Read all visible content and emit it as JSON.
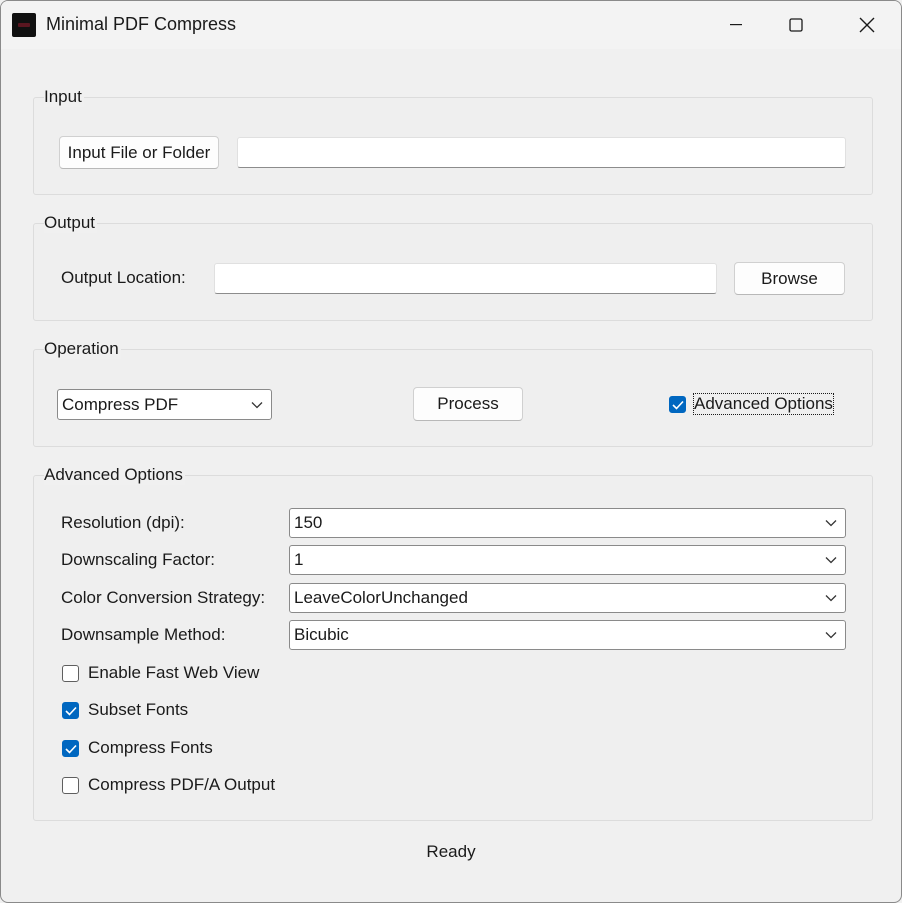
{
  "window": {
    "title": "Minimal PDF Compress"
  },
  "input_group": {
    "label": "Input",
    "button_label": "Input File or Folder",
    "path_value": ""
  },
  "output_group": {
    "label": "Output",
    "location_label": "Output Location:",
    "location_value": "",
    "browse_label": "Browse"
  },
  "operation_group": {
    "label": "Operation",
    "operation_value": "Compress PDF",
    "process_label": "Process",
    "advanced_toggle_label": "Advanced Options",
    "advanced_toggle_checked": true
  },
  "advanced_group": {
    "label": "Advanced Options",
    "fields": [
      {
        "label": "Resolution (dpi):",
        "value": "150"
      },
      {
        "label": "Downscaling Factor:",
        "value": "1"
      },
      {
        "label": "Color Conversion Strategy:",
        "value": "LeaveColorUnchanged"
      },
      {
        "label": "Downsample Method:",
        "value": "Bicubic"
      }
    ],
    "checkboxes": [
      {
        "label": "Enable Fast Web View",
        "checked": false
      },
      {
        "label": "Subset Fonts",
        "checked": true
      },
      {
        "label": "Compress Fonts",
        "checked": true
      },
      {
        "label": "Compress PDF/A Output",
        "checked": false
      }
    ]
  },
  "status": {
    "text": "Ready"
  },
  "colors": {
    "accent": "#0067c0",
    "background": "#f0f0f0"
  }
}
